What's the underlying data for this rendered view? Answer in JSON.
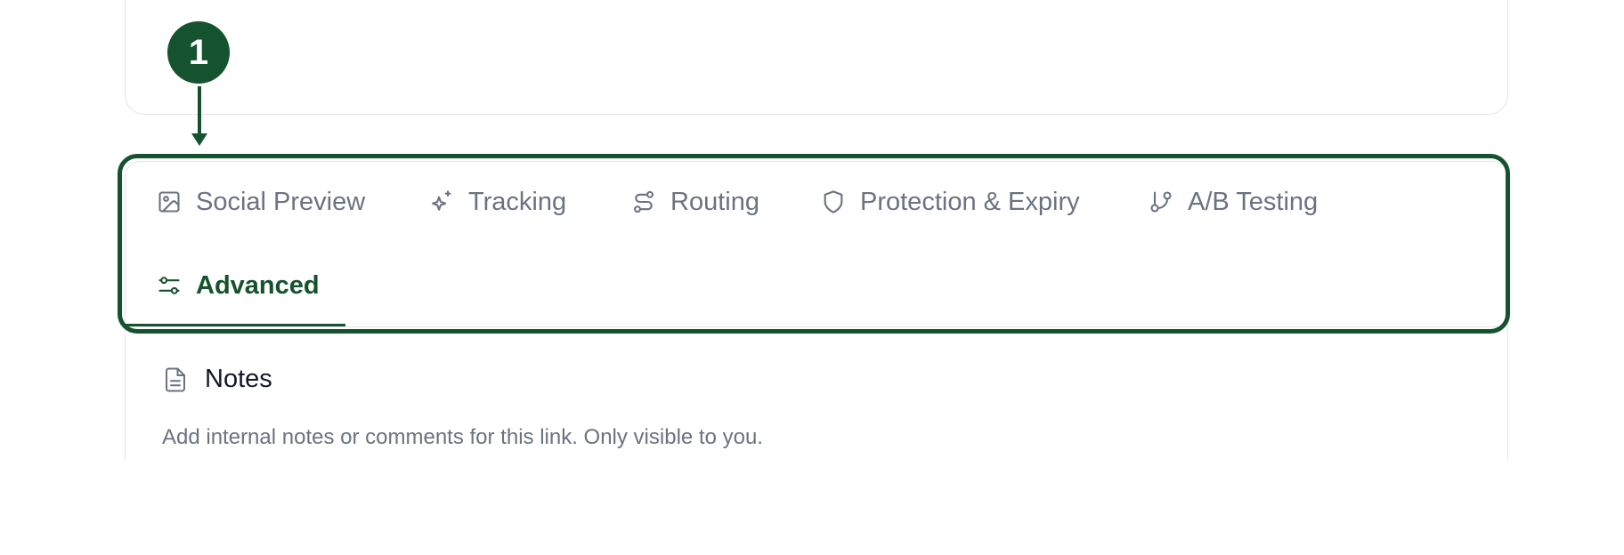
{
  "annotation": {
    "step_number": "1",
    "color": "#14532d"
  },
  "tabs": {
    "items": [
      {
        "label": "Social Preview",
        "icon": "image-icon",
        "active": false
      },
      {
        "label": "Tracking",
        "icon": "sparkles-icon",
        "active": false
      },
      {
        "label": "Routing",
        "icon": "route-icon",
        "active": false
      },
      {
        "label": "Protection & Expiry",
        "icon": "shield-icon",
        "active": false
      },
      {
        "label": "A/B Testing",
        "icon": "git-branch-icon",
        "active": false
      },
      {
        "label": "Advanced",
        "icon": "sliders-icon",
        "active": true
      }
    ],
    "active_color": "#14532d",
    "inactive_color": "#6b7280"
  },
  "notes_section": {
    "title": "Notes",
    "icon": "document-icon",
    "description": "Add internal notes or comments for this link. Only visible to you."
  }
}
